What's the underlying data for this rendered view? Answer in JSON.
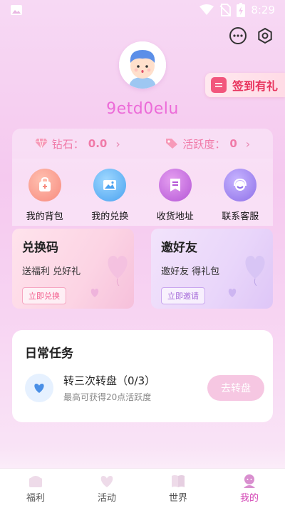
{
  "status_bar": {
    "time": "8:29"
  },
  "header": {
    "username": "9etd0elu",
    "sign_in_label": "签到有礼"
  },
  "stats": [
    {
      "label": "钻石：",
      "value": "0.0"
    },
    {
      "label": "活跃度：",
      "value": "0"
    }
  ],
  "features": [
    {
      "label": "我的背包",
      "icon": "backpack-icon"
    },
    {
      "label": "我的兑换",
      "icon": "image-icon"
    },
    {
      "label": "收货地址",
      "icon": "address-icon"
    },
    {
      "label": "联系客服",
      "icon": "headset-icon"
    }
  ],
  "promos": [
    {
      "title": "兑换码",
      "subtitle": "送福利 兑好礼",
      "button": "立即兑换"
    },
    {
      "title": "邀好友",
      "subtitle": "邀好友 得礼包",
      "button": "立即邀请"
    }
  ],
  "daily": {
    "title": "日常任务",
    "task_name": "转三次转盘（0/3）",
    "task_desc": "最高可获得20点活跃度",
    "task_button": "去转盘"
  },
  "nav": [
    {
      "label": "福利"
    },
    {
      "label": "活动"
    },
    {
      "label": "世界"
    },
    {
      "label": "我的"
    }
  ],
  "colors": {
    "accent": "#d447b6",
    "username": "#ec6bd8",
    "sign_in": "#e8335d"
  }
}
